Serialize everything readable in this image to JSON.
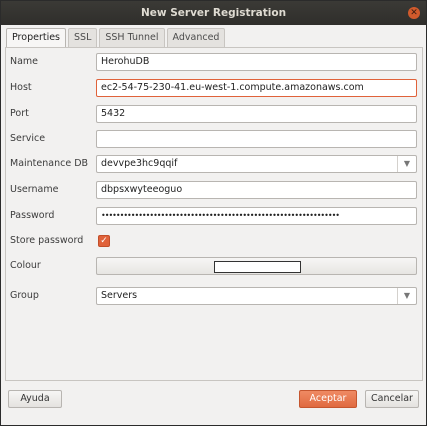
{
  "window": {
    "title": "New Server Registration"
  },
  "tabs": [
    {
      "label": "Properties"
    },
    {
      "label": "SSL"
    },
    {
      "label": "SSH Tunnel"
    },
    {
      "label": "Advanced"
    }
  ],
  "form": {
    "name": {
      "label": "Name",
      "value": "HerohuDB"
    },
    "host": {
      "label": "Host",
      "value": "ec2-54-75-230-41.eu-west-1.compute.amazonaws.com"
    },
    "port": {
      "label": "Port",
      "value": "5432"
    },
    "service": {
      "label": "Service",
      "value": ""
    },
    "maintenance_db": {
      "label": "Maintenance DB",
      "value": "devvpe3hc9qqif"
    },
    "username": {
      "label": "Username",
      "value": "dbpsxwyteeoguo"
    },
    "password": {
      "label": "Password",
      "value": "••••••••••••••••••••••••••••••••••••••••••••••••••••••••••••••••"
    },
    "store_password": {
      "label": "Store password",
      "checked": true
    },
    "colour": {
      "label": "Colour",
      "value": "#ffffff"
    },
    "group": {
      "label": "Group",
      "value": "Servers"
    }
  },
  "buttons": {
    "help": "Ayuda",
    "ok": "Aceptar",
    "cancel": "Cancelar"
  },
  "colors": {
    "accent": "#e0623a",
    "titlebar": "#2f2e2b"
  }
}
